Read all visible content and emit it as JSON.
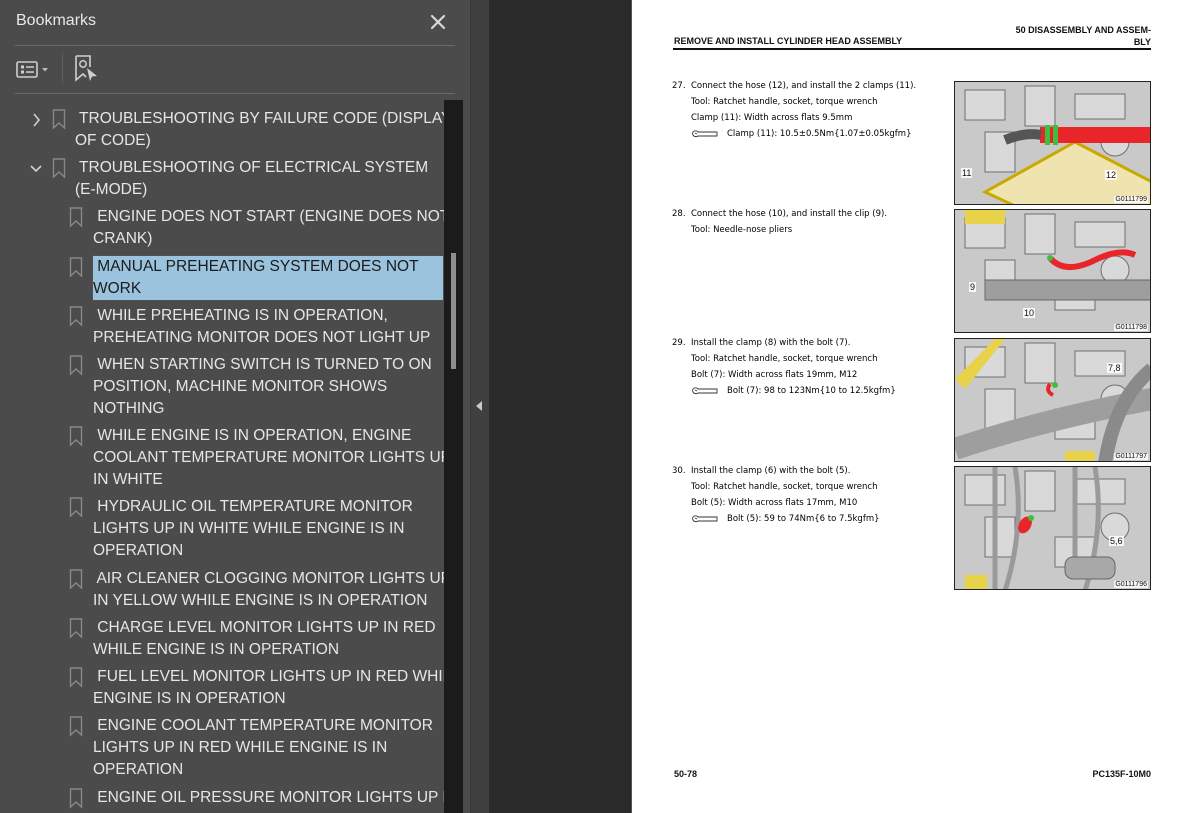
{
  "bookmarks_panel": {
    "title": "Bookmarks",
    "close_icon": "close-icon",
    "toolbar": {
      "options_icon": "list-options-icon",
      "find_icon": "find-current-bookmark-icon"
    },
    "selected_index": 3,
    "items": [
      {
        "label": "TROUBLESHOOTING BY FAILURE CODE (DISPLAY OF CODE)",
        "lines": [
          " TROUBLESHOOTING BY FAILURE CODE (DISPLAY",
          "OF CODE)"
        ],
        "level": 0,
        "expander": "collapsed"
      },
      {
        "label": "TROUBLESHOOTING OF ELECTRICAL SYSTEM (E-MODE)",
        "lines": [
          " TROUBLESHOOTING OF ELECTRICAL SYSTEM",
          "(E-MODE)"
        ],
        "level": 0,
        "expander": "expanded"
      },
      {
        "label": "ENGINE DOES NOT START (ENGINE DOES NOT CRANK)",
        "lines": [
          " ENGINE DOES NOT START (ENGINE DOES NOT",
          "CRANK)"
        ],
        "level": 1
      },
      {
        "label": "MANUAL PREHEATING SYSTEM DOES NOT WORK",
        "lines": [
          " MANUAL PREHEATING SYSTEM DOES NOT",
          "WORK"
        ],
        "level": 1
      },
      {
        "label": "WHILE PREHEATING IS IN OPERATION, PREHEATING MONITOR DOES NOT LIGHT UP",
        "lines": [
          " WHILE PREHEATING IS IN OPERATION,",
          "PREHEATING MONITOR DOES NOT LIGHT UP"
        ],
        "level": 1
      },
      {
        "label": "WHEN STARTING SWITCH IS TURNED TO ON POSITION, MACHINE MONITOR SHOWS NOTHING",
        "lines": [
          " WHEN STARTING SWITCH IS TURNED TO ON",
          "POSITION, MACHINE MONITOR SHOWS",
          "NOTHING"
        ],
        "level": 1
      },
      {
        "label": "WHILE ENGINE IS IN OPERATION, ENGINE COOLANT TEMPERATURE MONITOR LIGHTS UP IN WHITE",
        "lines": [
          " WHILE ENGINE IS IN OPERATION, ENGINE",
          "COOLANT TEMPERATURE MONITOR LIGHTS UP",
          "IN WHITE"
        ],
        "level": 1
      },
      {
        "label": "HYDRAULIC OIL TEMPERATURE MONITOR LIGHTS UP IN WHITE WHILE ENGINE IS IN OPERATION",
        "lines": [
          " HYDRAULIC OIL TEMPERATURE MONITOR",
          "LIGHTS UP IN WHITE WHILE ENGINE IS IN",
          "OPERATION"
        ],
        "level": 1
      },
      {
        "label": "AIR CLEANER CLOGGING MONITOR LIGHTS UP IN YELLOW WHILE ENGINE IS IN OPERATION",
        "lines": [
          " AIR CLEANER CLOGGING MONITOR LIGHTS UP",
          "IN YELLOW WHILE ENGINE IS IN OPERATION"
        ],
        "level": 1
      },
      {
        "label": "CHARGE LEVEL MONITOR LIGHTS UP IN RED WHILE ENGINE IS IN OPERATION",
        "lines": [
          " CHARGE LEVEL MONITOR LIGHTS UP IN RED",
          "WHILE ENGINE IS IN OPERATION"
        ],
        "level": 1
      },
      {
        "label": "FUEL LEVEL MONITOR LIGHTS UP IN RED WHILE ENGINE IS IN OPERATION",
        "lines": [
          " FUEL LEVEL MONITOR LIGHTS UP IN RED WHILE",
          "ENGINE IS IN OPERATION"
        ],
        "level": 1
      },
      {
        "label": "ENGINE COOLANT TEMPERATURE MONITOR LIGHTS UP IN RED WHILE ENGINE IS IN OPERATION",
        "lines": [
          " ENGINE COOLANT TEMPERATURE MONITOR",
          "LIGHTS UP IN RED WHILE ENGINE IS IN",
          "OPERATION"
        ],
        "level": 1
      },
      {
        "label": "ENGINE OIL PRESSURE MONITOR LIGHTS UP IN ...",
        "lines": [
          " ENGINE OIL PRESSURE MONITOR LIGHTS UP IN"
        ],
        "level": 1
      }
    ],
    "colors": {
      "panel_bg": "#4b4b4b",
      "selection_bg": "#9bc3de",
      "text": "#e6e6e6"
    }
  },
  "document": {
    "header_left": "REMOVE AND INSTALL CYLINDER HEAD ASSEMBLY",
    "header_right_lines": [
      "50 DISASSEMBLY AND ASSEM-",
      "BLY"
    ],
    "steps": [
      {
        "number": "27.",
        "lines": [
          "Connect the hose (12), and install the 2 clamps (11).",
          "Tool: Ratchet handle, socket, torque wrench",
          "Clamp (11): Width across flats 9.5mm"
        ],
        "torque": "Clamp (11): 10.5±0.5Nm{1.07±0.05kgfm}",
        "figure": {
          "id": "G0111799",
          "callouts": [
            "11",
            "12"
          ]
        }
      },
      {
        "number": "28.",
        "lines": [
          "Connect the hose (10), and install the clip (9).",
          "Tool: Needle-nose pliers"
        ],
        "torque": null,
        "figure": {
          "id": "G0111798",
          "callouts": [
            "9",
            "10"
          ]
        }
      },
      {
        "number": "29.",
        "lines": [
          "Install the clamp (8) with the bolt (7).",
          "Tool: Ratchet handle, socket, torque wrench",
          "Bolt (7): Width across flats 19mm, M12"
        ],
        "torque": "Bolt (7): 98 to 123Nm{10 to 12.5kgfm}",
        "figure": {
          "id": "G0111797",
          "callouts": [
            "7,8"
          ]
        }
      },
      {
        "number": "30.",
        "lines": [
          "Install the clamp (6) with the bolt (5).",
          "Tool: Ratchet handle, socket, torque wrench",
          "Bolt (5): Width across flats 17mm, M10"
        ],
        "torque": "Bolt (5): 59 to 74Nm{6 to 7.5kgfm}",
        "figure": {
          "id": "G0111796",
          "callouts": [
            "5,6"
          ]
        }
      }
    ],
    "page_number": "50-78",
    "model_code": "PC135F-10M0"
  }
}
